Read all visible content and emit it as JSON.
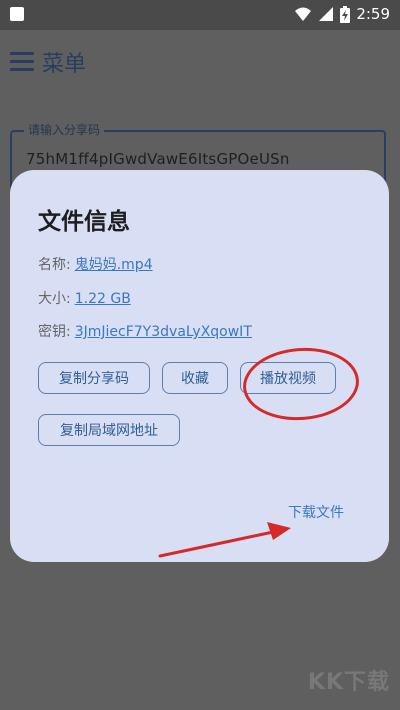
{
  "status_bar": {
    "time": "2:59"
  },
  "app_bar": {
    "title": "菜单"
  },
  "share_input": {
    "label": "请输入分享码",
    "value": "75hM1ff4pIGwdVawE6ItsGPOeUSn"
  },
  "dialog": {
    "title": "文件信息",
    "rows": [
      {
        "label": "名称:",
        "value": "鬼妈妈.mp4"
      },
      {
        "label": "大小:",
        "value": "1.22 GB"
      },
      {
        "label": "密钥:",
        "value": "3JmJiecF7Y3dvaLyXqowIT"
      }
    ],
    "buttons": {
      "copy_share_code": "复制分享码",
      "favorite": "收藏",
      "play_video": "播放视频",
      "copy_lan_address": "复制局域网地址"
    },
    "download": "下载文件"
  },
  "watermark": "KK下载",
  "colors": {
    "accent": "#3d79c2",
    "dialog_bg": "#d8def4",
    "annotation": "#d62a2a"
  }
}
